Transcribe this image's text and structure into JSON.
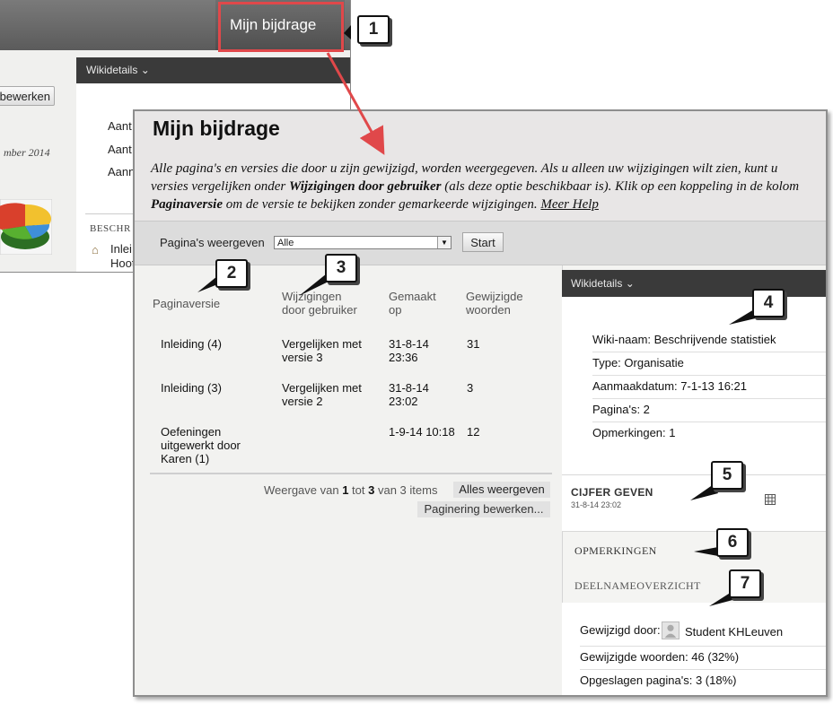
{
  "background": {
    "tab_label": "Mijn bijdrage",
    "edit_button_label": "bewerken",
    "wikidetails_label": "Wikidetails",
    "aant_labels": [
      "Aant",
      "Aant",
      "Aann"
    ],
    "date_fragment": "mber 2014",
    "beschr_label": "BESCHR",
    "item_1": "Inlei",
    "item_2": "Hoot"
  },
  "main": {
    "title": "Mijn bijdrage",
    "description": {
      "part1": "Alle pagina's en versies die door u zijn gewijzigd, worden weergegeven. Als u alleen uw wijzigingen wilt zien, kunt u versies vergelijken onder ",
      "bold1": "Wijzigingen door gebruiker",
      "part2": " (als deze optie beschikbaar is). Klik op een koppeling in de kolom ",
      "bold2": "Paginaversie",
      "part3": " om de versie te bekijken zonder gemarkeerde wijzigingen. ",
      "link": "Meer Help"
    },
    "filter": {
      "label": "Pagina's weergeven",
      "selected": "Alle",
      "start_label": "Start"
    },
    "table": {
      "headers": {
        "version": "Paginaversie",
        "changes_line1": "Wijzigingen",
        "changes_line2": "door gebruiker",
        "made_line1": "Gemaakt",
        "made_line2": "op",
        "words_line1": "Gewijzigde",
        "words_line2": "woorden"
      },
      "rows": [
        {
          "version": "Inleiding (4)",
          "compare_line1": "Vergelijken met",
          "compare_line2": "versie 3",
          "date_line1": "31-8-14",
          "date_line2": "23:36",
          "words": "31"
        },
        {
          "version": "Inleiding (3)",
          "compare_line1": "Vergelijken met",
          "compare_line2": "versie 2",
          "date_line1": "31-8-14",
          "date_line2": "23:02",
          "words": "3"
        },
        {
          "version_line1": "Oefeningen",
          "version_line2": "uitgewerkt door",
          "version_line3": "Karen (1)",
          "date_line1": "1-9-14 10:18",
          "words": "12"
        }
      ]
    },
    "pagination": {
      "prefix": "Weergave van ",
      "from": "1",
      "middle": " tot ",
      "to": "3",
      "suffix": " van 3 items",
      "show_all_label": "Alles weergeven",
      "edit_label": "Paginering bewerken..."
    },
    "sidebar": {
      "wikidetails_label": "Wikidetails",
      "details": [
        "Wiki-naam: Beschrijvende statistiek",
        "Type: Organisatie",
        "Aanmaakdatum: 7-1-13 16:21",
        "Pagina's: 2",
        "Opmerkingen: 1"
      ],
      "grade_title": "CIJFER GEVEN",
      "grade_date": "31-8-14 23:02",
      "comments_title": "OPMERKINGEN",
      "overview_title": "DEELNAMEOVERZICHT",
      "modified_by_label": "Gewijzigd door:",
      "modified_by_user": "Student KHLeuven",
      "changed_words": "Gewijzigde woorden: 46 (32%)",
      "saved_pages": "Opgeslagen pagina's: 3 (18%)"
    }
  },
  "callouts": [
    "1",
    "2",
    "3",
    "4",
    "5",
    "6",
    "7"
  ],
  "colors": {
    "highlight": "#e0484a",
    "dark_bar": "#3a3a3a",
    "header_bg": "#e8e6e6"
  }
}
